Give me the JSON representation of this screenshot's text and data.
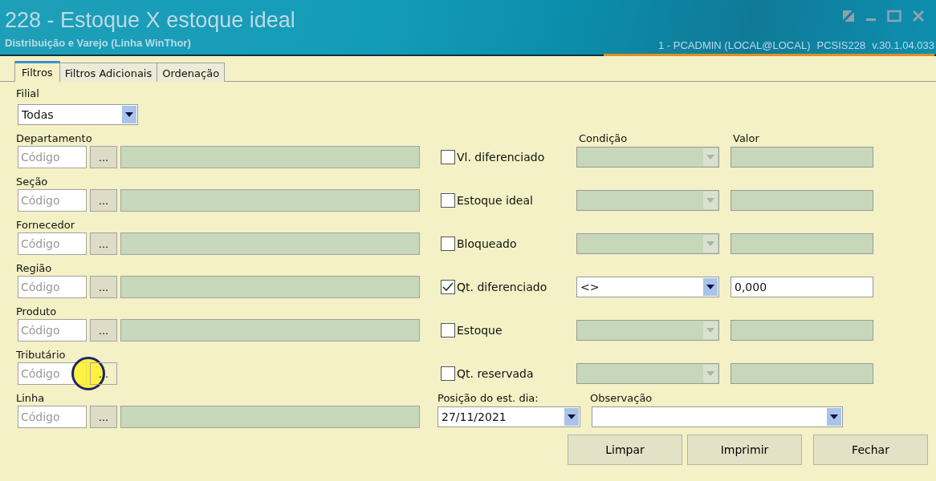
{
  "window": {
    "title": "228 - Estoque X estoque ideal",
    "subtitle": "Distribuição e Varejo (Linha WinThor)",
    "status": [
      "1 - PCADMIN (LOCAL@LOCAL)",
      "PCSIS228",
      "v.30.1.04.033"
    ]
  },
  "tabs": [
    {
      "label": "Filtros",
      "selected": true
    },
    {
      "label": "Filtros Adicionais",
      "selected": false
    },
    {
      "label": "Ordenação",
      "selected": false
    }
  ],
  "filial": {
    "label": "Filial",
    "value": "Todas"
  },
  "lookups": [
    {
      "label": "Departamento",
      "placeholder": "Código",
      "button": "...",
      "description_field": true,
      "cursor_highlight": false
    },
    {
      "label": "Seção",
      "placeholder": "Código",
      "button": "...",
      "description_field": true,
      "cursor_highlight": false
    },
    {
      "label": "Fornecedor",
      "placeholder": "Código",
      "button": "...",
      "description_field": true,
      "cursor_highlight": false
    },
    {
      "label": "Região",
      "placeholder": "Código",
      "button": "...",
      "description_field": true,
      "cursor_highlight": false
    },
    {
      "label": "Produto",
      "placeholder": "Código",
      "button": "...",
      "description_field": true,
      "cursor_highlight": false
    },
    {
      "label": "Tributário",
      "placeholder": "Código",
      "button": "...",
      "description_field": false,
      "cursor_highlight": true
    },
    {
      "label": "Linha",
      "placeholder": "Código",
      "button": "...",
      "description_field": true,
      "cursor_highlight": false
    }
  ],
  "conditions": {
    "condition_header": "Condição",
    "value_header": "Valor",
    "rows": [
      {
        "label": "Vl. diferenciado",
        "checked": false
      },
      {
        "label": "Estoque ideal",
        "checked": false
      },
      {
        "label": "Bloqueado",
        "checked": false
      },
      {
        "label": "Qt. diferenciado",
        "checked": true,
        "condition": "<>",
        "value": "0,000"
      },
      {
        "label": "Estoque",
        "checked": false
      },
      {
        "label": "Qt. reservada",
        "checked": false
      }
    ]
  },
  "position": {
    "label": "Posição do est. dia:",
    "value": "27/11/2021"
  },
  "observation": {
    "label": "Observação"
  },
  "buttons": [
    {
      "label": "Limpar"
    },
    {
      "label": "Imprimir"
    },
    {
      "label": "Fechar"
    }
  ]
}
